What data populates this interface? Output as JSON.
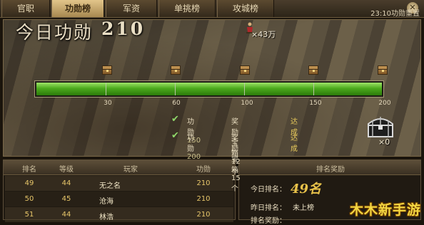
{
  "tabs": [
    {
      "label": "官职",
      "active": false
    },
    {
      "label": "功勋榜",
      "active": true
    },
    {
      "label": "军资",
      "active": false
    },
    {
      "label": "单挑榜",
      "active": false
    },
    {
      "label": "攻城榜",
      "active": false
    }
  ],
  "close_label": "✕",
  "reset_text": "23:10功勋重置",
  "honor": {
    "title": "今日功勋",
    "value": "210"
  },
  "bonus": "×43万",
  "progress": {
    "max": 200,
    "current": 210,
    "ticks": [
      "30",
      "60",
      "100",
      "150",
      "200"
    ],
    "fill_fraction": 1.0
  },
  "rewards": [
    {
      "honor_label": "功勋",
      "honor_num": "150",
      "reward": "奖励宝箱12个",
      "status": "达成"
    },
    {
      "honor_label": "功勋",
      "honor_num": "200",
      "reward": "奖励宝箱15个",
      "status": "达成"
    }
  ],
  "treasure_count": "×0",
  "ranking_table": {
    "headers": [
      "排名",
      "等级",
      "玩家",
      "功勋"
    ],
    "rows": [
      {
        "rank": "49",
        "level": "44",
        "name": "无之名",
        "honor": "210"
      },
      {
        "rank": "50",
        "level": "45",
        "name": "沧海",
        "honor": "210"
      },
      {
        "rank": "51",
        "level": "44",
        "name": "林浩",
        "honor": "210"
      }
    ]
  },
  "rank_panel": {
    "header": "排名奖励",
    "today_label": "今日排名：",
    "today_rank": "49名",
    "yesterday_label": "昨日排名：",
    "yesterday_value": "未上榜",
    "reward_label": "排名奖励："
  },
  "watermark": "木木新手游",
  "colors": {
    "accent_gold": "#e8c24a",
    "bar_green": "#4caa1d",
    "status_yellow": "#e6c85a"
  }
}
